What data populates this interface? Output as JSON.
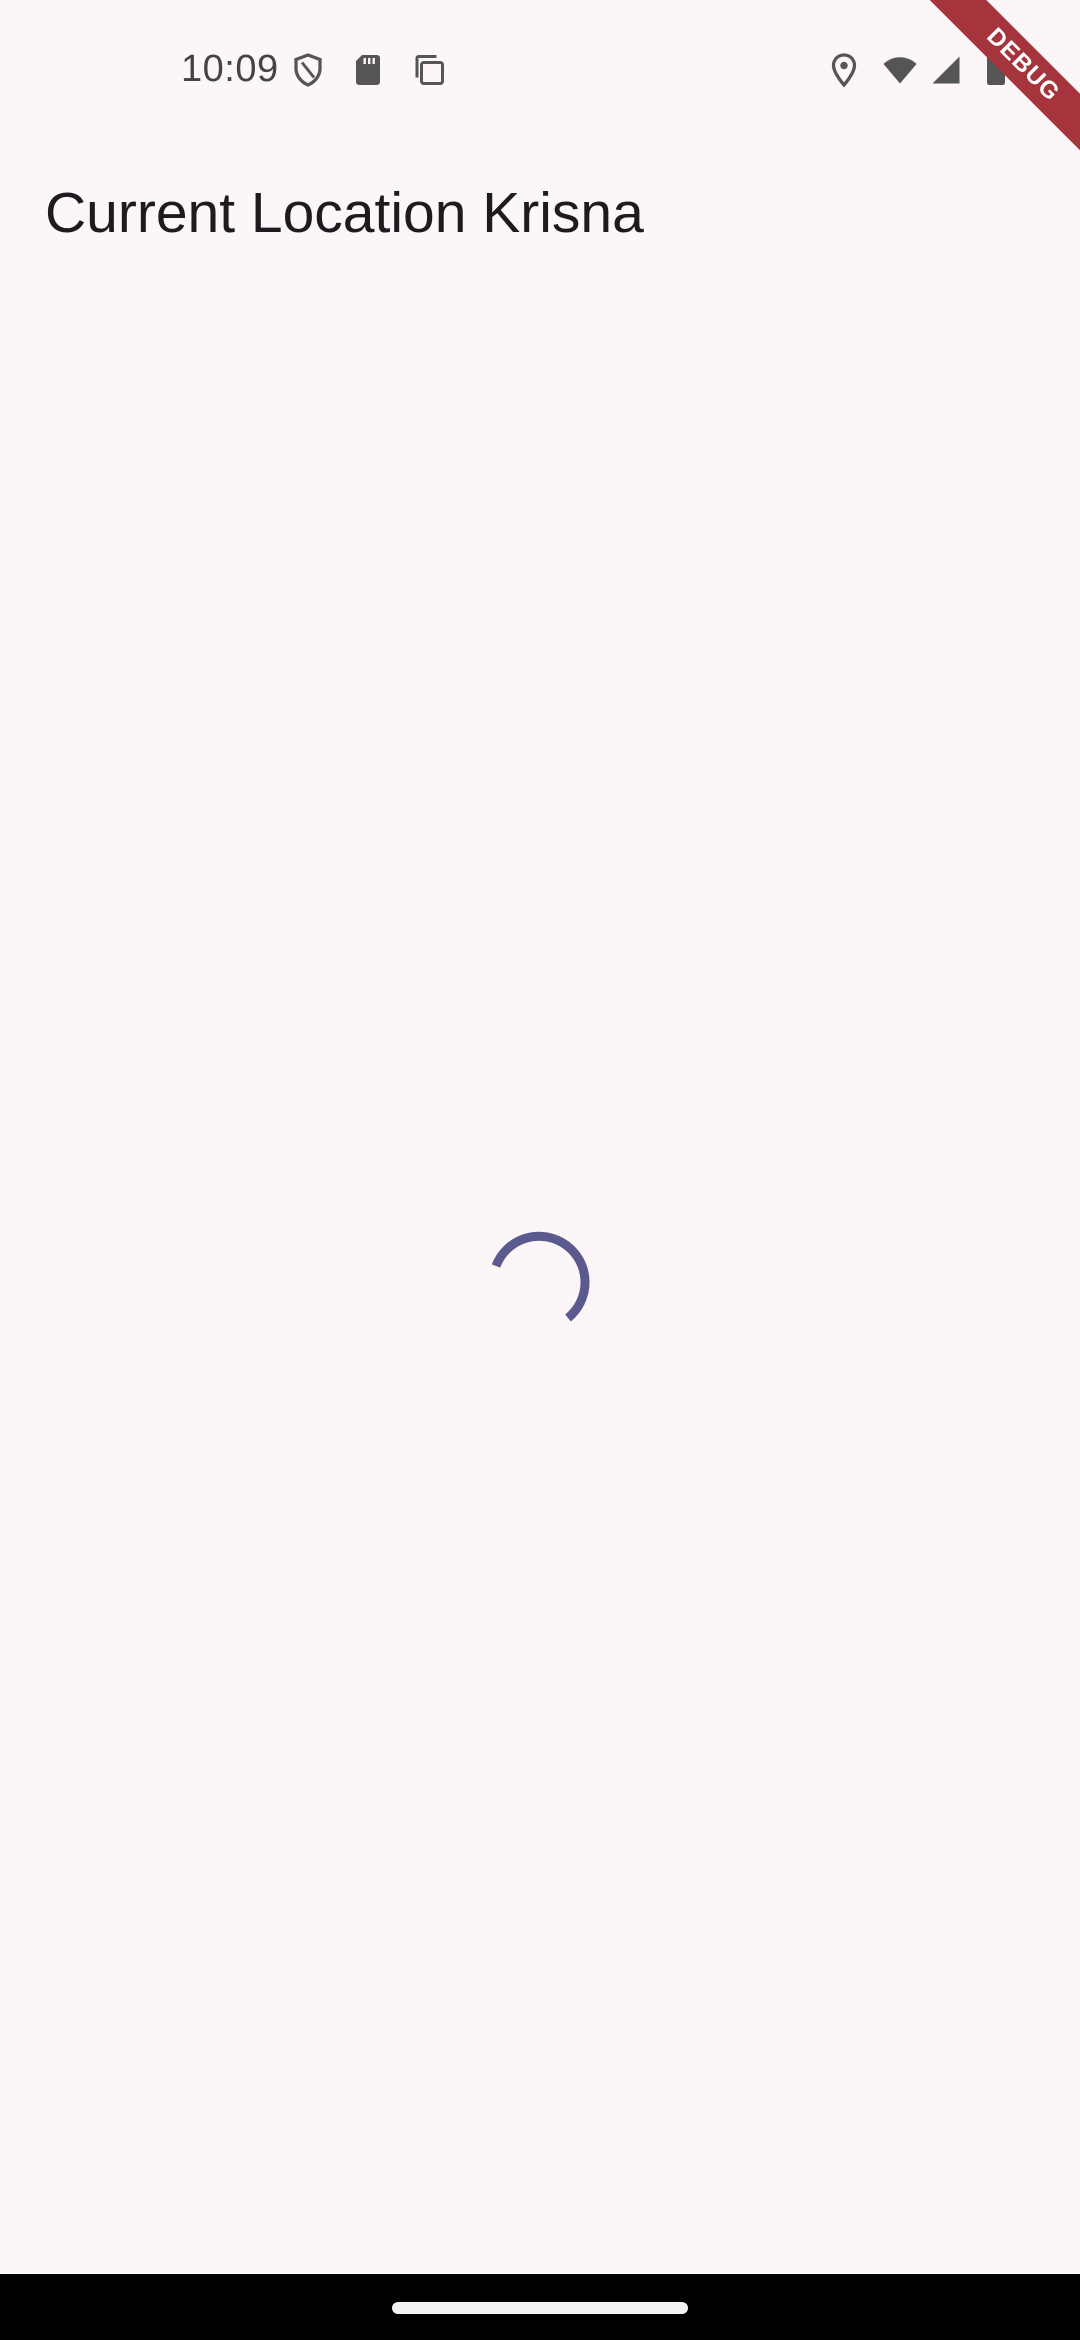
{
  "status_bar": {
    "time": "10:09",
    "left_icons": [
      "shield-icon",
      "sd-card-icon",
      "copy-icon"
    ],
    "right_icons": [
      "location-pin-icon",
      "wifi-icon",
      "signal-icon",
      "battery-icon"
    ]
  },
  "app_bar": {
    "title": "Current Location Krisna"
  },
  "debug_banner": {
    "label": "DEBUG",
    "color": "#a5343c"
  },
  "content": {
    "loading_indicator": "progress-spinner-icon",
    "accent_color": "#5a5a8e"
  },
  "colors": {
    "background": "#fdf6f8",
    "nav_bar": "#000000"
  }
}
